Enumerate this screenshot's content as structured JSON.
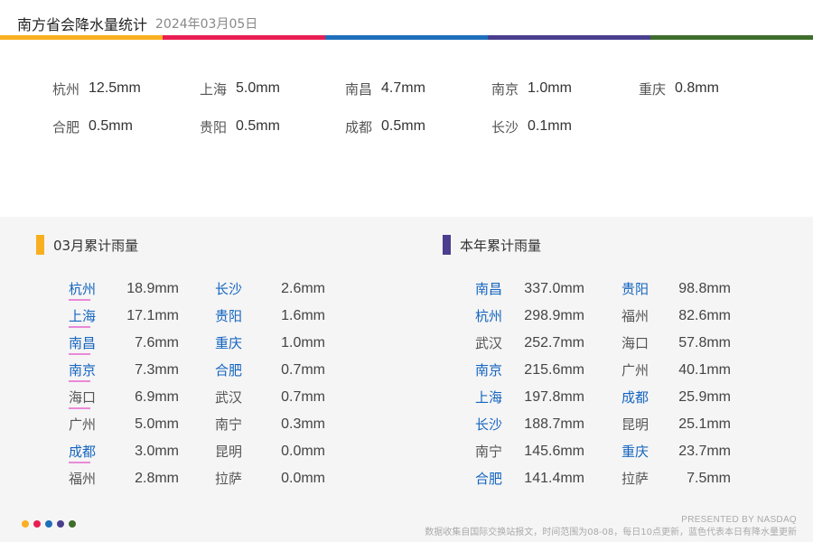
{
  "header": {
    "title": "南方省会降水量统计",
    "date": "2024年03月05日"
  },
  "colors": [
    "#f9b020",
    "#e91e52",
    "#1e6fbb",
    "#4a3f8e",
    "#3f6e2c"
  ],
  "today": [
    {
      "city": "杭州",
      "value": "12.5mm"
    },
    {
      "city": "上海",
      "value": "5.0mm"
    },
    {
      "city": "南昌",
      "value": "4.7mm"
    },
    {
      "city": "南京",
      "value": "1.0mm"
    },
    {
      "city": "重庆",
      "value": "0.8mm"
    },
    {
      "city": "合肥",
      "value": "0.5mm"
    },
    {
      "city": "贵阳",
      "value": "0.5mm"
    },
    {
      "city": "成都",
      "value": "0.5mm"
    },
    {
      "city": "长沙",
      "value": "0.1mm"
    }
  ],
  "monthly": {
    "title": "03月累计雨量",
    "accent": "#f9b020",
    "rows": [
      {
        "city": "杭州",
        "value": "18.9mm",
        "blue": true
      },
      {
        "city": "上海",
        "value": "17.1mm",
        "blue": true
      },
      {
        "city": "南昌",
        "value": "7.6mm",
        "blue": true
      },
      {
        "city": "南京",
        "value": "7.3mm",
        "blue": true
      },
      {
        "city": "海口",
        "value": "6.9mm",
        "blue": false
      },
      {
        "city": "广州",
        "value": "5.0mm",
        "blue": false
      },
      {
        "city": "成都",
        "value": "3.0mm",
        "blue": true
      },
      {
        "city": "福州",
        "value": "2.8mm",
        "blue": false
      },
      {
        "city": "长沙",
        "value": "2.6mm",
        "blue": true
      },
      {
        "city": "贵阳",
        "value": "1.6mm",
        "blue": true
      },
      {
        "city": "重庆",
        "value": "1.0mm",
        "blue": true
      },
      {
        "city": "合肥",
        "value": "0.7mm",
        "blue": true
      },
      {
        "city": "武汉",
        "value": "0.7mm",
        "blue": false
      },
      {
        "city": "南宁",
        "value": "0.3mm",
        "blue": false
      },
      {
        "city": "昆明",
        "value": "0.0mm",
        "blue": false
      },
      {
        "city": "拉萨",
        "value": "0.0mm",
        "blue": false
      }
    ]
  },
  "yearly": {
    "title": "本年累计雨量",
    "accent": "#4a3f8e",
    "rows": [
      {
        "city": "南昌",
        "value": "337.0mm",
        "blue": true
      },
      {
        "city": "杭州",
        "value": "298.9mm",
        "blue": true
      },
      {
        "city": "武汉",
        "value": "252.7mm",
        "blue": false
      },
      {
        "city": "南京",
        "value": "215.6mm",
        "blue": true
      },
      {
        "city": "上海",
        "value": "197.8mm",
        "blue": true
      },
      {
        "city": "长沙",
        "value": "188.7mm",
        "blue": true
      },
      {
        "city": "南宁",
        "value": "145.6mm",
        "blue": false
      },
      {
        "city": "合肥",
        "value": "141.4mm",
        "blue": true
      },
      {
        "city": "贵阳",
        "value": "98.8mm",
        "blue": true
      },
      {
        "city": "福州",
        "value": "82.6mm",
        "blue": false
      },
      {
        "city": "海口",
        "value": "57.8mm",
        "blue": false
      },
      {
        "city": "广州",
        "value": "40.1mm",
        "blue": false
      },
      {
        "city": "成都",
        "value": "25.9mm",
        "blue": true
      },
      {
        "city": "昆明",
        "value": "25.1mm",
        "blue": false
      },
      {
        "city": "重庆",
        "value": "23.7mm",
        "blue": true
      },
      {
        "city": "拉萨",
        "value": "7.5mm",
        "blue": false
      }
    ]
  },
  "footer": {
    "credit": "PRESENTED BY NASDAQ",
    "note": "数据收集自国际交换站报文，时间范围为08-08，每日10点更新，蓝色代表本日有降水量更新"
  }
}
